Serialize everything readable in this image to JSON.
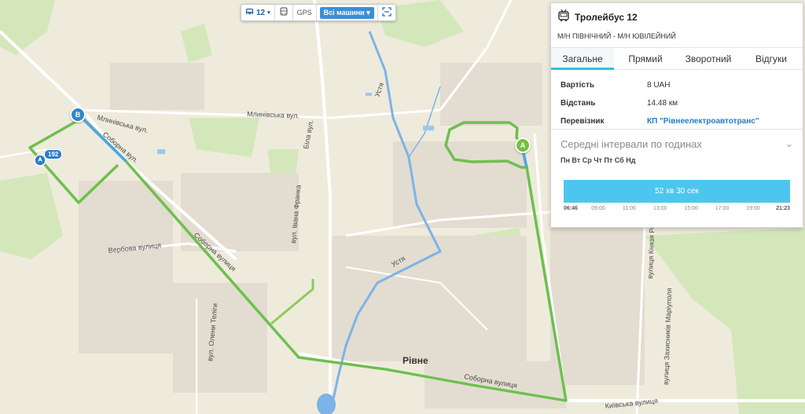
{
  "toolbar": {
    "route_number": "12",
    "gps_label": "GPS",
    "vehicles_select": "Всі машини"
  },
  "panel": {
    "title": "Тролейбус 12",
    "subtitle": "М/Н ПІВНІЧНИЙ - М/Н ЮВІЛЕЙНИЙ",
    "tabs": [
      {
        "label": "Загальне",
        "active": true
      },
      {
        "label": "Прямий",
        "active": false
      },
      {
        "label": "Зворотний",
        "active": false
      },
      {
        "label": "Відгуки",
        "active": false
      }
    ],
    "info": {
      "cost_label": "Вартість",
      "cost_value": "8 UAH",
      "distance_label": "Відстань",
      "distance_value": "14.48 км",
      "carrier_label": "Перевізник",
      "carrier_value": "КП \"Рівнеелектроавтотранс\""
    },
    "intervals": {
      "title": "Середні інтервали по годинах",
      "days": "Пн Вт Ср Чт Пт Сб Нд",
      "bar_label": "52 хв 30 сек",
      "start_time": "06:46",
      "end_time": "21:23",
      "start_hour": 6.7667,
      "end_hour": 21.3833,
      "ticks": [
        "09:00",
        "11:00",
        "13:00",
        "15:00",
        "17:00",
        "19:00"
      ],
      "tick_hours": [
        9,
        11,
        13,
        15,
        17,
        19
      ]
    }
  },
  "map": {
    "markers": {
      "start": "A",
      "end": "B"
    },
    "vehicle_number": "192",
    "city_name": "Рівне",
    "streets": {
      "mlynivska_1": "Млинівська вул.",
      "mlynivska_2": "Млинівська вул.",
      "soborna_1": "Соборна вул.",
      "soborna_2": "Соборна вулиця",
      "soborna_3": "Соборна вулиця",
      "verbova": "Вербова вулиця",
      "bila": "Біла вул.",
      "ivana_franka": "вул. Івана Франка",
      "olenykh_teligy": "вул. Олени Теліги",
      "kyivska": "Київська вулиця",
      "usta": "Устя",
      "usta2": "Устя",
      "kniazia": "вулиця Князя Романа",
      "zakhidna": "вулиця Захисників Маріуполя"
    },
    "colors": {
      "route_green": "#6fbf4f",
      "route_blue": "#4aa6e6",
      "river": "#7cb3e8",
      "park": "#cfe6b4"
    }
  }
}
